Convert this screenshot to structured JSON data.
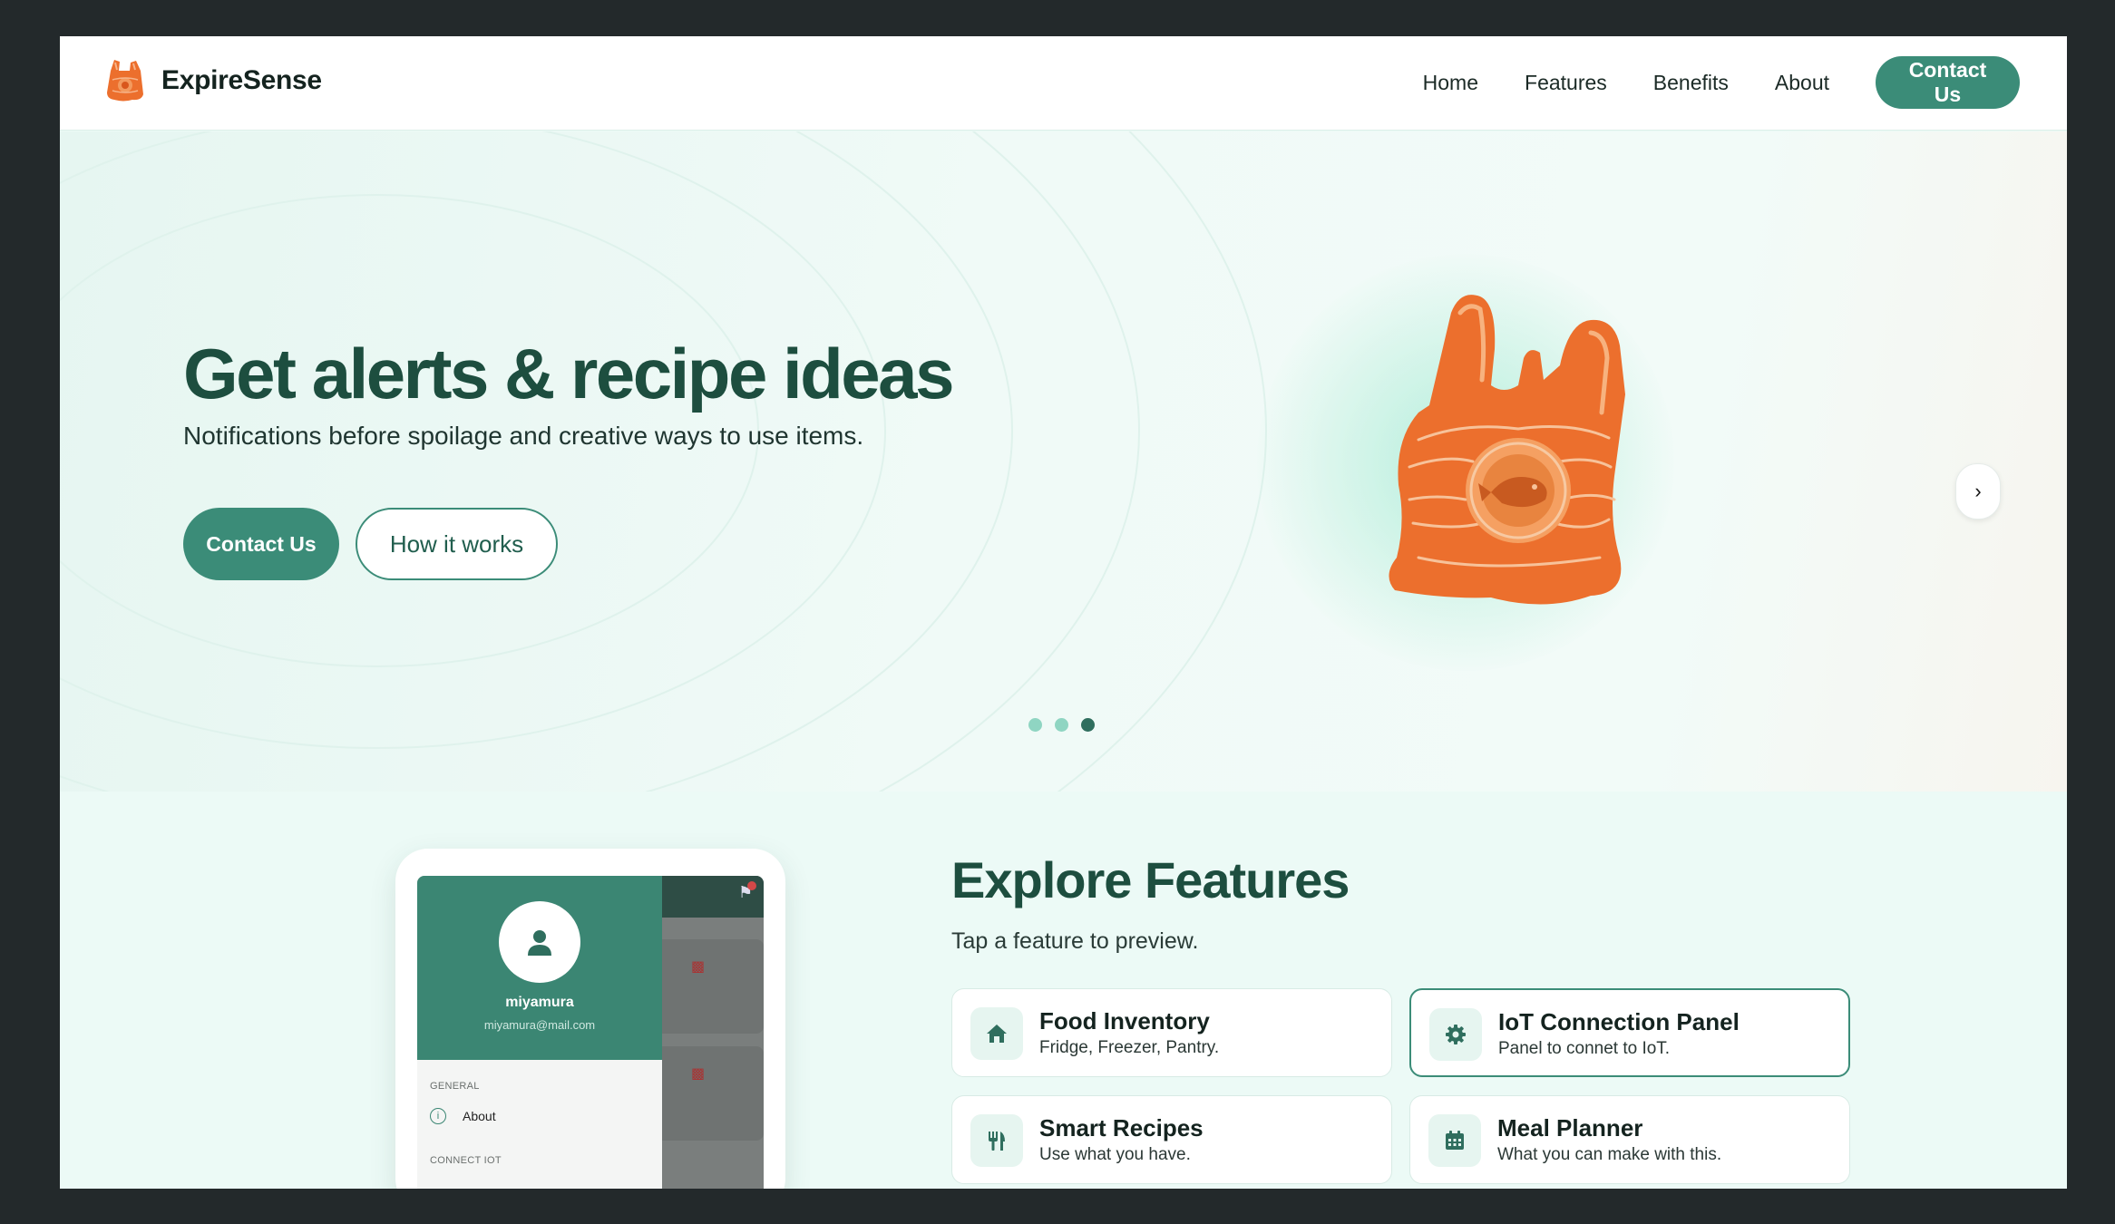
{
  "brand": {
    "name": "ExpireSense",
    "logo_icon": "shopping-bag-logo"
  },
  "nav": {
    "links": [
      "Home",
      "Features",
      "Benefits",
      "About"
    ],
    "cta": "Contact Us"
  },
  "hero": {
    "title": "Get alerts & recipe ideas",
    "subtitle": "Notifications before spoilage and creative ways to use items.",
    "primary_cta": "Contact Us",
    "secondary_cta": "How it works",
    "illustration": "orange-plastic-bag-illustration",
    "next_arrow": "›",
    "carousel": {
      "slides": 3,
      "active": 3
    }
  },
  "phone_preview": {
    "user_name": "miyamura",
    "user_email": "miyamura@mail.com",
    "section_general": "GENERAL",
    "item_about": "About",
    "section_connect": "CONNECT IOT"
  },
  "features": {
    "title": "Explore Features",
    "subtitle": "Tap a feature to preview.",
    "cards": [
      {
        "name": "Food Inventory",
        "desc": "Fridge, Freezer, Pantry.",
        "icon": "home-icon",
        "selected": false
      },
      {
        "name": "IoT Connection Panel",
        "desc": "Panel to connet to IoT.",
        "icon": "gear-icon",
        "selected": true
      },
      {
        "name": "Smart Recipes",
        "desc": "Use what you have.",
        "icon": "utensils-icon",
        "selected": false
      },
      {
        "name": "Meal Planner",
        "desc": "What you can make with this.",
        "icon": "calendar-icon",
        "selected": false
      }
    ]
  },
  "colors": {
    "accent": "#3b8c78",
    "heading": "#1d4e3f",
    "bag_orange": "#ec6f2d",
    "frame": "#23292b"
  }
}
